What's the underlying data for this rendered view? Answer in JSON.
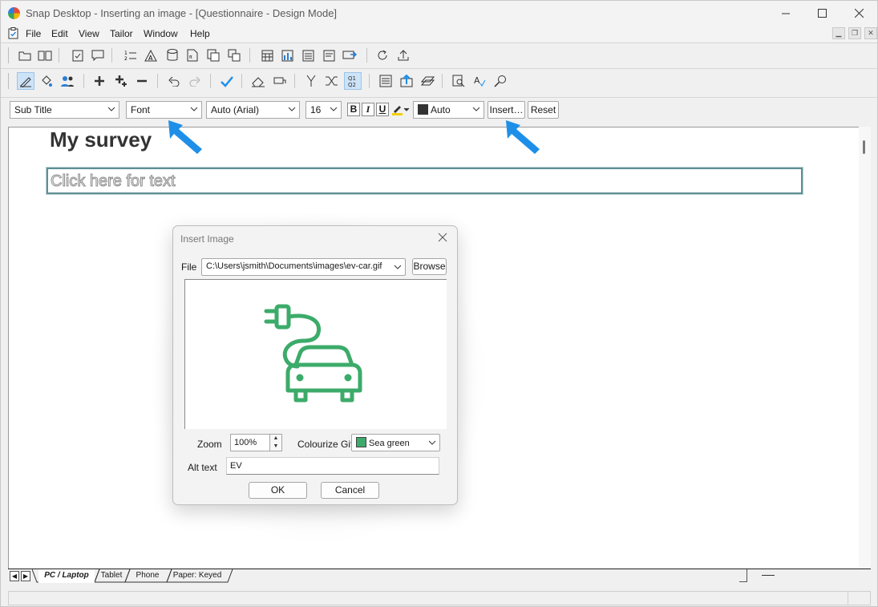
{
  "window": {
    "title": "Snap Desktop - Inserting an image  - [Questionnaire - Design Mode]"
  },
  "menu": [
    "File",
    "Edit",
    "View",
    "Tailor",
    "Window",
    "Help"
  ],
  "format_bar": {
    "style_value": "Sub Title",
    "font_value": "Font",
    "font_name_value": "Auto (Arial)",
    "font_size_value": "16",
    "bold_label": "B",
    "italic_label": "I",
    "underline_label": "U",
    "color_value": "Auto",
    "insert_label": "Insert…",
    "reset_label": "Reset"
  },
  "toolbar": {
    "q1q2_label_top": "Q1",
    "q1q2_label_bottom": "Q2"
  },
  "canvas": {
    "survey_title": "My survey",
    "text_placeholder": "Click here for text"
  },
  "tabs": {
    "items": [
      "PC / Laptop",
      "Tablet",
      "Phone",
      "Paper: Keyed"
    ],
    "active": "PC / Laptop"
  },
  "dialog": {
    "title": "Insert Image",
    "file_label": "File",
    "file_value": "C:\\Users\\jsmith\\Documents\\images\\ev-car.gif",
    "browse_label": "Browse",
    "zoom_label": "Zoom",
    "zoom_value": "100%",
    "colourize_label": "Colourize Gif",
    "colourize_value": "Sea green",
    "alt_text_label": "Alt text",
    "alt_text_value": "EV",
    "ok_label": "OK",
    "cancel_label": "Cancel"
  },
  "colors": {
    "sea_green": "#3cab6a",
    "arrow_blue": "#1e8fe8",
    "color_swatch": "#333333"
  },
  "icons": {
    "preview_image": "ev-car-plug-icon"
  }
}
